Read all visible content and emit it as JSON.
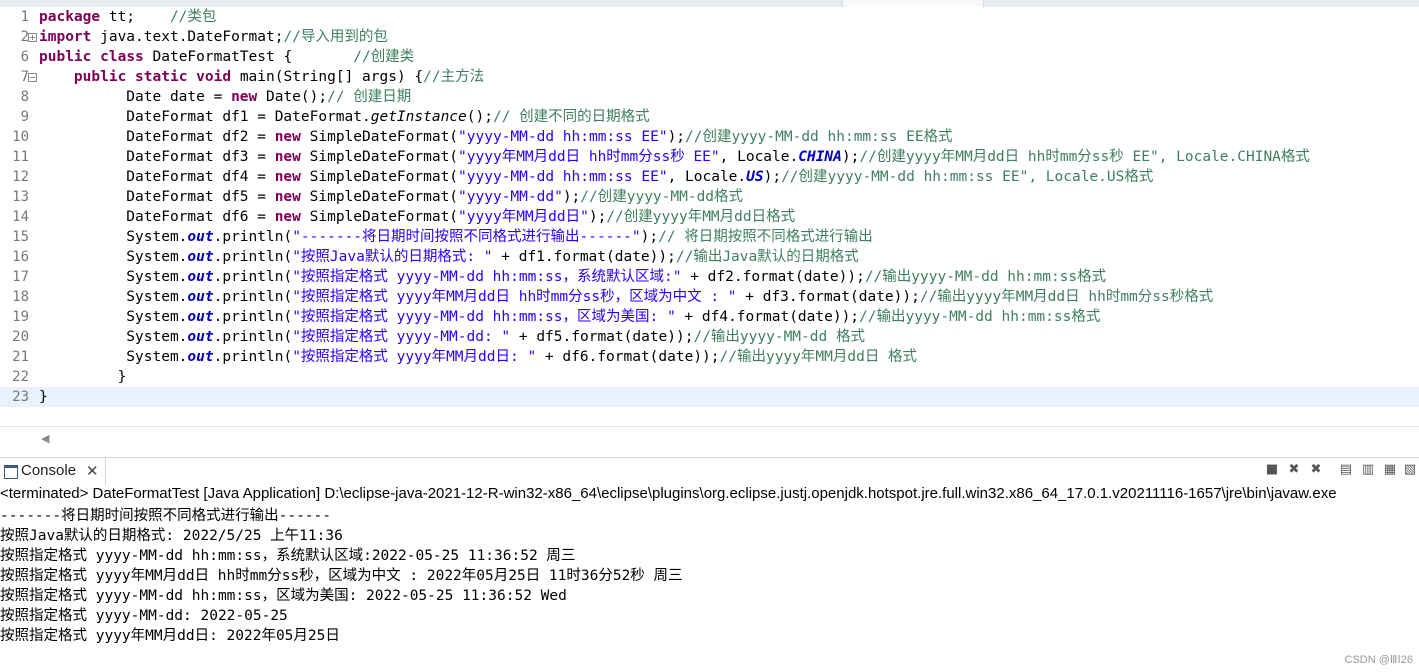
{
  "editor": {
    "lines": [
      {
        "num": "1",
        "segs": [
          {
            "t": "package",
            "c": "kw"
          },
          {
            "t": " tt;    "
          },
          {
            "t": "//类包",
            "c": "cm"
          }
        ]
      },
      {
        "num": "2",
        "fold": "+",
        "segs": [
          {
            "t": "import",
            "c": "kw"
          },
          {
            "t": " java.text.DateFormat;"
          },
          {
            "t": "//导入用到的包",
            "c": "cm"
          }
        ]
      },
      {
        "num": "6",
        "segs": [
          {
            "t": "public",
            "c": "kw"
          },
          {
            "t": " "
          },
          {
            "t": "class",
            "c": "kw"
          },
          {
            "t": " DateFormatTest {       "
          },
          {
            "t": "//创建类",
            "c": "cm"
          }
        ]
      },
      {
        "num": "7",
        "fold": "−",
        "segs": [
          {
            "t": "    "
          },
          {
            "t": "public",
            "c": "kw"
          },
          {
            "t": " "
          },
          {
            "t": "static",
            "c": "kw"
          },
          {
            "t": " "
          },
          {
            "t": "void",
            "c": "kw"
          },
          {
            "t": " main(String[] args) {"
          },
          {
            "t": "//主方法",
            "c": "cm"
          }
        ]
      },
      {
        "num": "8",
        "segs": [
          {
            "t": "          Date date = "
          },
          {
            "t": "new",
            "c": "kw"
          },
          {
            "t": " Date();"
          },
          {
            "t": "// 创建日期",
            "c": "cm"
          }
        ]
      },
      {
        "num": "9",
        "segs": [
          {
            "t": "          DateFormat df1 = DateFormat."
          },
          {
            "t": "getInstance",
            "c": "it"
          },
          {
            "t": "();"
          },
          {
            "t": "// 创建不同的日期格式",
            "c": "cm"
          }
        ]
      },
      {
        "num": "10",
        "segs": [
          {
            "t": "          DateFormat df2 = "
          },
          {
            "t": "new",
            "c": "kw"
          },
          {
            "t": " SimpleDateFormat("
          },
          {
            "t": "\"yyyy-MM-dd hh:mm:ss EE\"",
            "c": "st"
          },
          {
            "t": ");"
          },
          {
            "t": "//创建yyyy-MM-dd hh:mm:ss EE格式",
            "c": "cm"
          }
        ]
      },
      {
        "num": "11",
        "segs": [
          {
            "t": "          DateFormat df3 = "
          },
          {
            "t": "new",
            "c": "kw"
          },
          {
            "t": " SimpleDateFormat("
          },
          {
            "t": "\"yyyy年MM月dd日 hh时mm分ss秒 EE\"",
            "c": "st"
          },
          {
            "t": ", Locale."
          },
          {
            "t": "CHINA",
            "c": "fld"
          },
          {
            "t": ");"
          },
          {
            "t": "//创建yyyy年MM月dd日 hh时mm分ss秒 EE\", Locale.CHINA格式",
            "c": "cm"
          }
        ]
      },
      {
        "num": "12",
        "segs": [
          {
            "t": "          DateFormat df4 = "
          },
          {
            "t": "new",
            "c": "kw"
          },
          {
            "t": " SimpleDateFormat("
          },
          {
            "t": "\"yyyy-MM-dd hh:mm:ss EE\"",
            "c": "st"
          },
          {
            "t": ", Locale."
          },
          {
            "t": "US",
            "c": "fld"
          },
          {
            "t": ");"
          },
          {
            "t": "//创建yyyy-MM-dd hh:mm:ss EE\", Locale.US格式",
            "c": "cm"
          }
        ]
      },
      {
        "num": "13",
        "segs": [
          {
            "t": "          DateFormat df5 = "
          },
          {
            "t": "new",
            "c": "kw"
          },
          {
            "t": " SimpleDateFormat("
          },
          {
            "t": "\"yyyy-MM-dd\"",
            "c": "st"
          },
          {
            "t": ");"
          },
          {
            "t": "//创建yyyy-MM-dd格式",
            "c": "cm"
          }
        ]
      },
      {
        "num": "14",
        "segs": [
          {
            "t": "          DateFormat df6 = "
          },
          {
            "t": "new",
            "c": "kw"
          },
          {
            "t": " SimpleDateFormat("
          },
          {
            "t": "\"yyyy年MM月dd日\"",
            "c": "st"
          },
          {
            "t": ");"
          },
          {
            "t": "//创建yyyy年MM月dd日格式",
            "c": "cm"
          }
        ]
      },
      {
        "num": "15",
        "segs": [
          {
            "t": "          System."
          },
          {
            "t": "out",
            "c": "fld"
          },
          {
            "t": ".println("
          },
          {
            "t": "\"-------将日期时间按照不同格式进行输出------\"",
            "c": "st"
          },
          {
            "t": ");"
          },
          {
            "t": "// 将日期按照不同格式进行输出",
            "c": "cm"
          }
        ]
      },
      {
        "num": "16",
        "segs": [
          {
            "t": "          System."
          },
          {
            "t": "out",
            "c": "fld"
          },
          {
            "t": ".println("
          },
          {
            "t": "\"按照Java默认的日期格式: \"",
            "c": "st"
          },
          {
            "t": " + df1.format(date));"
          },
          {
            "t": "//输出Java默认的日期格式",
            "c": "cm"
          }
        ]
      },
      {
        "num": "17",
        "segs": [
          {
            "t": "          System."
          },
          {
            "t": "out",
            "c": "fld"
          },
          {
            "t": ".println("
          },
          {
            "t": "\"按照指定格式 yyyy-MM-dd hh:mm:ss，系统默认区域:\"",
            "c": "st"
          },
          {
            "t": " + df2.format(date));"
          },
          {
            "t": "//输出yyyy-MM-dd hh:mm:ss格式",
            "c": "cm"
          }
        ]
      },
      {
        "num": "18",
        "segs": [
          {
            "t": "          System."
          },
          {
            "t": "out",
            "c": "fld"
          },
          {
            "t": ".println("
          },
          {
            "t": "\"按照指定格式 yyyy年MM月dd日 hh时mm分ss秒，区域为中文 : \"",
            "c": "st"
          },
          {
            "t": " + df3.format(date));"
          },
          {
            "t": "//输出yyyy年MM月dd日 hh时mm分ss秒格式",
            "c": "cm"
          }
        ]
      },
      {
        "num": "19",
        "segs": [
          {
            "t": "          System."
          },
          {
            "t": "out",
            "c": "fld"
          },
          {
            "t": ".println("
          },
          {
            "t": "\"按照指定格式 yyyy-MM-dd hh:mm:ss，区域为美国: \"",
            "c": "st"
          },
          {
            "t": " + df4.format(date));"
          },
          {
            "t": "//输出yyyy-MM-dd hh:mm:ss格式",
            "c": "cm"
          }
        ]
      },
      {
        "num": "20",
        "segs": [
          {
            "t": "          System."
          },
          {
            "t": "out",
            "c": "fld"
          },
          {
            "t": ".println("
          },
          {
            "t": "\"按照指定格式 yyyy-MM-dd: \"",
            "c": "st"
          },
          {
            "t": " + df5.format(date));"
          },
          {
            "t": "//输出yyyy-MM-dd 格式",
            "c": "cm"
          }
        ]
      },
      {
        "num": "21",
        "segs": [
          {
            "t": "          System."
          },
          {
            "t": "out",
            "c": "fld"
          },
          {
            "t": ".println("
          },
          {
            "t": "\"按照指定格式 yyyy年MM月dd日: \"",
            "c": "st"
          },
          {
            "t": " + df6.format(date));"
          },
          {
            "t": "//输出yyyy年MM月dd日 格式",
            "c": "cm"
          }
        ]
      },
      {
        "num": "22",
        "segs": [
          {
            "t": "         }"
          }
        ]
      },
      {
        "num": "23",
        "current": true,
        "segs": [
          {
            "t": "}"
          }
        ]
      }
    ]
  },
  "console": {
    "tab_label": "Console",
    "close_glyph": "✕",
    "toolbar_icons": [
      "terminate-icon",
      "remove-launch-icon",
      "remove-all-icon",
      "scroll-lock-icon",
      "word-wrap-icon",
      "pin-console-icon",
      "display-console-icon"
    ],
    "terminated": "<terminated> DateFormatTest [Java Application] D:\\eclipse-java-2021-12-R-win32-x86_64\\eclipse\\plugins\\org.eclipse.justj.openjdk.hotspot.jre.full.win32.x86_64_17.0.1.v20211116-1657\\jre\\bin\\javaw.exe",
    "output": [
      "-------将日期时间按照不同格式进行输出------",
      "按照Java默认的日期格式: 2022/5/25 上午11:36",
      "按照指定格式 yyyy-MM-dd hh:mm:ss，系统默认区域:2022-05-25 11:36:52 周三",
      "按照指定格式 yyyy年MM月dd日 hh时mm分ss秒，区域为中文 : 2022年05月25日 11时36分52秒 周三",
      "按照指定格式 yyyy-MM-dd hh:mm:ss，区域为美国: 2022-05-25 11:36:52 Wed",
      "按照指定格式 yyyy-MM-dd: 2022-05-25",
      "按照指定格式 yyyy年MM月dd日: 2022年05月25日"
    ]
  },
  "watermark": "CSDN @ⅢⅠ26",
  "colors": {
    "keyword": "#7f0055",
    "comment": "#3f7f5f",
    "string": "#2a00ff",
    "field": "#0000c0",
    "current_line": "#e8f2fe"
  }
}
